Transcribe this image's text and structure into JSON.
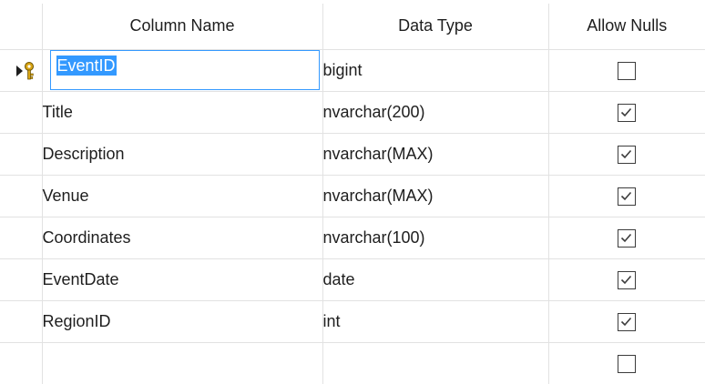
{
  "headers": {
    "name": "Column Name",
    "type": "Data Type",
    "nulls": "Allow Nulls"
  },
  "rows": [
    {
      "name": "EventID",
      "type": "bigint",
      "allow_nulls": false,
      "primary_key": true,
      "current": true
    },
    {
      "name": "Title",
      "type": "nvarchar(200)",
      "allow_nulls": true
    },
    {
      "name": "Description",
      "type": "nvarchar(MAX)",
      "allow_nulls": true
    },
    {
      "name": "Venue",
      "type": "nvarchar(MAX)",
      "allow_nulls": true
    },
    {
      "name": "Coordinates",
      "type": "nvarchar(100)",
      "allow_nulls": true
    },
    {
      "name": "EventDate",
      "type": "date",
      "allow_nulls": true
    },
    {
      "name": "RegionID",
      "type": "int",
      "allow_nulls": true
    },
    {
      "name": "",
      "type": "",
      "allow_nulls": false
    }
  ],
  "icons": {
    "row_indicator": "current-row-arrow-icon",
    "primary_key": "primary-key-icon",
    "checkbox": "checkbox-icon"
  },
  "colors": {
    "selection": "#3399ff",
    "key_gold": "#d9a514",
    "grid_line": "#e2e2e2"
  }
}
